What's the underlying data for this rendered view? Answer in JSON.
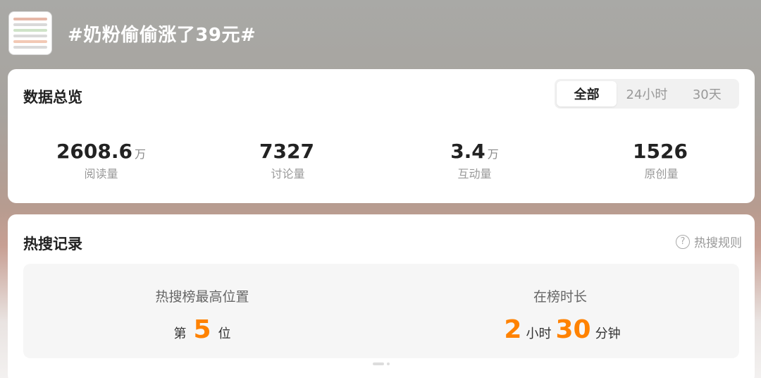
{
  "header": {
    "title": "#奶粉偷偷涨了39元#"
  },
  "overview": {
    "title": "数据总览",
    "tabs": [
      {
        "label": "全部",
        "active": true
      },
      {
        "label": "24小时",
        "active": false
      },
      {
        "label": "30天",
        "active": false
      }
    ],
    "stats": [
      {
        "value": "2608.6",
        "unit": "万",
        "label": "阅读量"
      },
      {
        "value": "7327",
        "unit": "",
        "label": "讨论量"
      },
      {
        "value": "3.4",
        "unit": "万",
        "label": "互动量"
      },
      {
        "value": "1526",
        "unit": "",
        "label": "原创量"
      }
    ]
  },
  "hot": {
    "title": "热搜记录",
    "rules_label": "热搜规则",
    "rules_icon": "question-icon",
    "peak": {
      "label": "热搜榜最高位置",
      "prefix": "第",
      "value": "5",
      "suffix": "位"
    },
    "duration": {
      "label": "在榜时长",
      "hours": "2",
      "hours_unit": "小时",
      "minutes": "30",
      "minutes_unit": "分钟"
    }
  },
  "colors": {
    "accent": "#ff8200",
    "text": "#222222",
    "muted": "#999999"
  }
}
